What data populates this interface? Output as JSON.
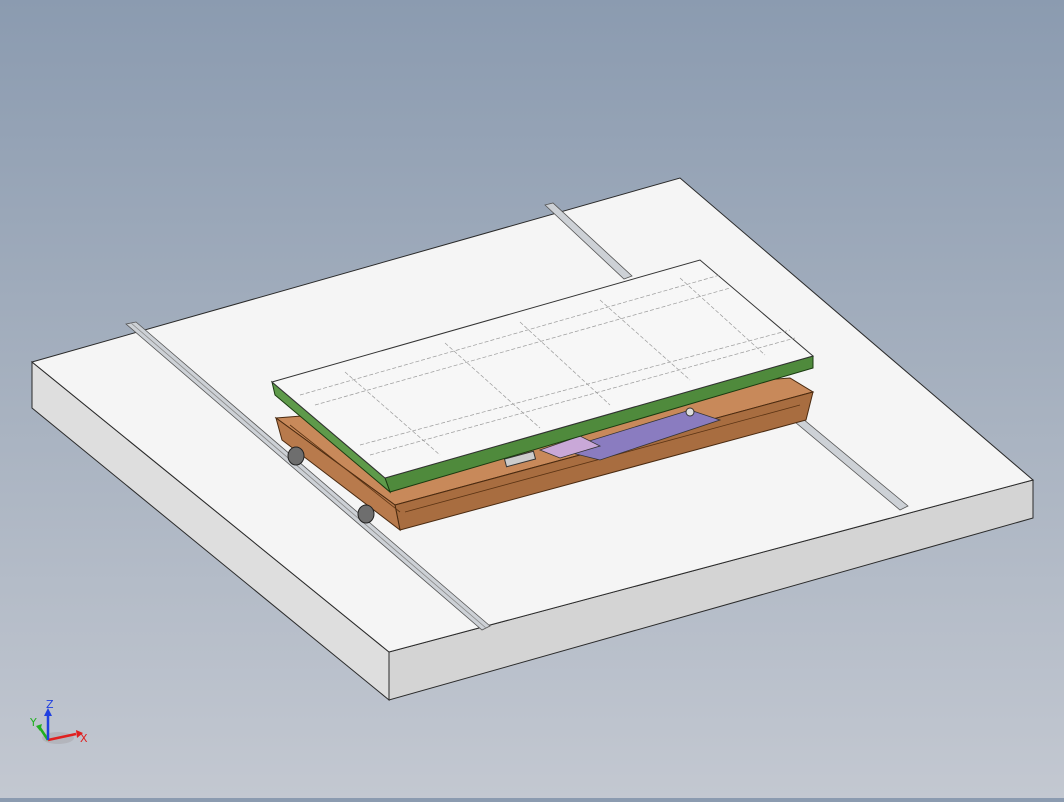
{
  "viewport": {
    "background_top": "#8b9bb0",
    "background_bottom": "#c3c8d1"
  },
  "model": {
    "floor_color": "#f4f4f4",
    "floor_side_color": "#dcdcdc",
    "rail_color": "#c9cdd2",
    "frame_color": "#c8895a",
    "top_plate_color": "#4f8a3c",
    "top_surface_color": "#f7f7f7",
    "link_color": "#8a7cc0",
    "wheel_color": "#6e6e6e"
  },
  "triad": {
    "x_label": "X",
    "y_label": "Y",
    "z_label": "Z",
    "x_color": "#e02020",
    "y_color": "#20b020",
    "z_color": "#2040e0"
  }
}
